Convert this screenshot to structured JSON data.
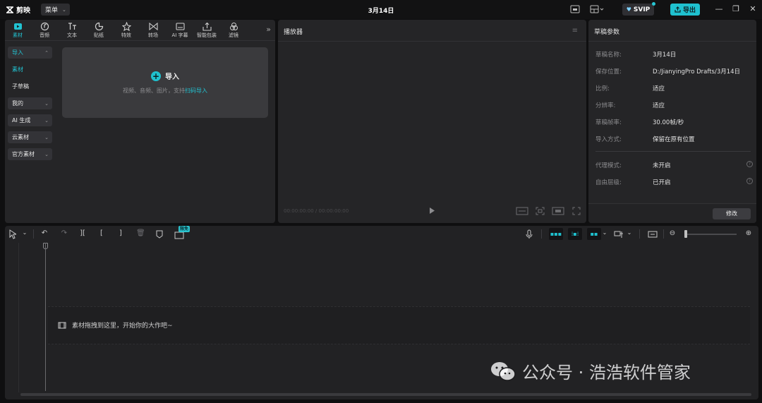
{
  "app": {
    "name": "剪映",
    "menu_label": "菜单",
    "title": "3月14日",
    "svip_label": "SVIP",
    "export_label": "导出"
  },
  "toolbar_tabs": [
    {
      "label": "素材",
      "icon": "media-icon",
      "active": true
    },
    {
      "label": "音频",
      "icon": "audio-icon"
    },
    {
      "label": "文本",
      "icon": "text-icon"
    },
    {
      "label": "贴纸",
      "icon": "sticker-icon"
    },
    {
      "label": "特效",
      "icon": "effects-icon"
    },
    {
      "label": "转场",
      "icon": "transition-icon"
    },
    {
      "label": "AI 字幕",
      "icon": "subtitle-icon"
    },
    {
      "label": "智能包装",
      "icon": "package-icon"
    },
    {
      "label": "滤镜",
      "icon": "filter-icon"
    }
  ],
  "left_nav": [
    {
      "label": "导入"
    },
    {
      "label": "素材"
    },
    {
      "label": "子草稿"
    },
    {
      "label": "我的"
    },
    {
      "label": "AI 生成"
    },
    {
      "label": "云素材"
    },
    {
      "label": "官方素材"
    }
  ],
  "import_area": {
    "title": "导入",
    "subtitle_prefix": "视频、音频、图片，支持",
    "subtitle_link": "扫码导入"
  },
  "player": {
    "title": "播放器",
    "timecode": "00:00:00:00 / 00:00:00:00"
  },
  "properties": {
    "title": "草稿参数",
    "rows": [
      {
        "label": "草稿名称:",
        "value": "3月14日"
      },
      {
        "label": "保存位置:",
        "value": "D:/JianyingPro Drafts/3月14日"
      },
      {
        "label": "比例:",
        "value": "适应"
      },
      {
        "label": "分辨率:",
        "value": "适应"
      },
      {
        "label": "草稿帧率:",
        "value": "30.00帧/秒"
      },
      {
        "label": "导入方式:",
        "value": "保留在原有位置"
      }
    ],
    "rows2": [
      {
        "label": "代理模式:",
        "value": "未开启"
      },
      {
        "label": "自由层级:",
        "value": "已开启"
      }
    ],
    "modify_label": "修改"
  },
  "timeline": {
    "limit_badge": "限免",
    "drop_hint": "素材拖拽到这里，开始你的大作吧~"
  },
  "watermark": {
    "text": "公众号 · 浩浩软件管家"
  }
}
